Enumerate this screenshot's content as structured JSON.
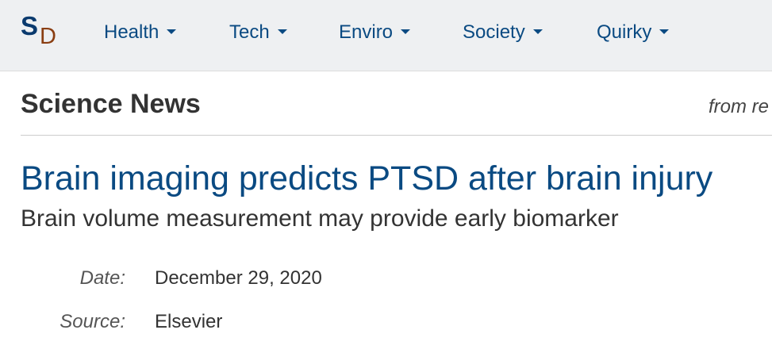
{
  "logo": {
    "letter_s": "S",
    "letter_d": "D"
  },
  "nav": {
    "items": [
      {
        "label": "Health"
      },
      {
        "label": "Tech"
      },
      {
        "label": "Enviro"
      },
      {
        "label": "Society"
      },
      {
        "label": "Quirky"
      }
    ]
  },
  "section": {
    "title": "Science News",
    "from_text": "from re"
  },
  "article": {
    "headline": "Brain imaging predicts PTSD after brain injury",
    "subheadline": "Brain volume measurement may provide early biomarker",
    "meta": [
      {
        "label": "Date:",
        "value": "December 29, 2020"
      },
      {
        "label": "Source:",
        "value": "Elsevier"
      }
    ]
  },
  "colors": {
    "nav_background": "#eef0f2",
    "link_blue": "#0a4a82",
    "logo_s": "#0a3a6e",
    "logo_d": "#8a3e12"
  }
}
